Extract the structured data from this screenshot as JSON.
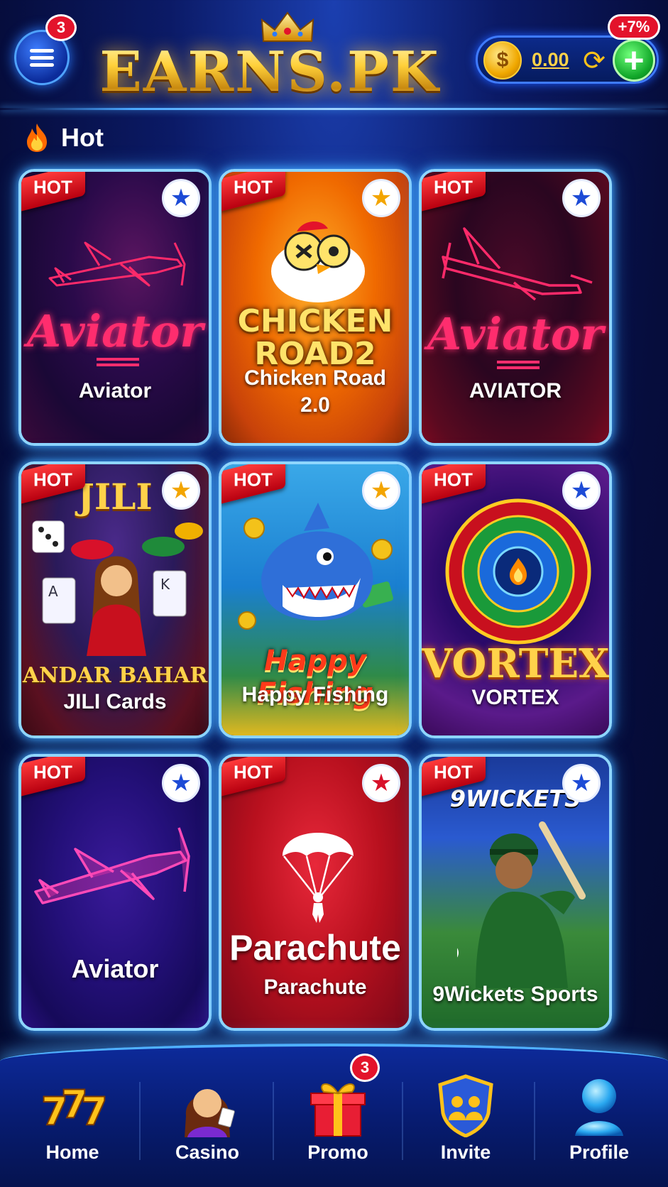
{
  "header": {
    "menu_badge": "3",
    "logo": "EARNS.PK",
    "balance": "0.00",
    "coin_symbol": "$",
    "bonus_badge": "+7%",
    "add_symbol": "+"
  },
  "section": {
    "title": "Hot"
  },
  "hot_tag": "HOT",
  "cards": [
    {
      "label": "Aviator",
      "art_text": "Aviator",
      "hot": true,
      "fav_icon": "star-icon"
    },
    {
      "label": "Chicken Road",
      "label2": "2.0",
      "art_text": "CHICKEN",
      "art_text2": "ROAD2",
      "hot": true,
      "fav_icon": "star-icon"
    },
    {
      "label": "AVIATOR",
      "art_text": "Aviator",
      "hot": true,
      "fav_icon": "star-icon"
    },
    {
      "label": "JILI Cards",
      "art_text": "JILI",
      "art_text2": "ANDAR BAHAR",
      "hot": true,
      "fav_icon": "star-icon"
    },
    {
      "label": "Happy Fishing",
      "art_text": "Happy Fishing",
      "hot": true,
      "fav_icon": "star-icon"
    },
    {
      "label": "VORTEX",
      "art_text": "VORTEX",
      "hot": true,
      "fav_icon": "star-icon"
    },
    {
      "label": "Aviator",
      "hot": true,
      "fav_icon": "star-icon"
    },
    {
      "label": "Parachute",
      "art_text": "Parachute",
      "hot": true,
      "fav_icon": "star-icon"
    },
    {
      "label": "9Wickets Sports",
      "art_text": "9WICKETS",
      "hot": true,
      "fav_icon": "star-icon"
    }
  ],
  "nav": {
    "home": "Home",
    "casino": "Casino",
    "promo": "Promo",
    "promo_badge": "3",
    "invite": "Invite",
    "profile": "Profile"
  },
  "colors": {
    "accent_blue": "#3fa6ff",
    "gold": "#ffd24a",
    "badge_red": "#e3132b",
    "add_green": "#12a82a"
  }
}
